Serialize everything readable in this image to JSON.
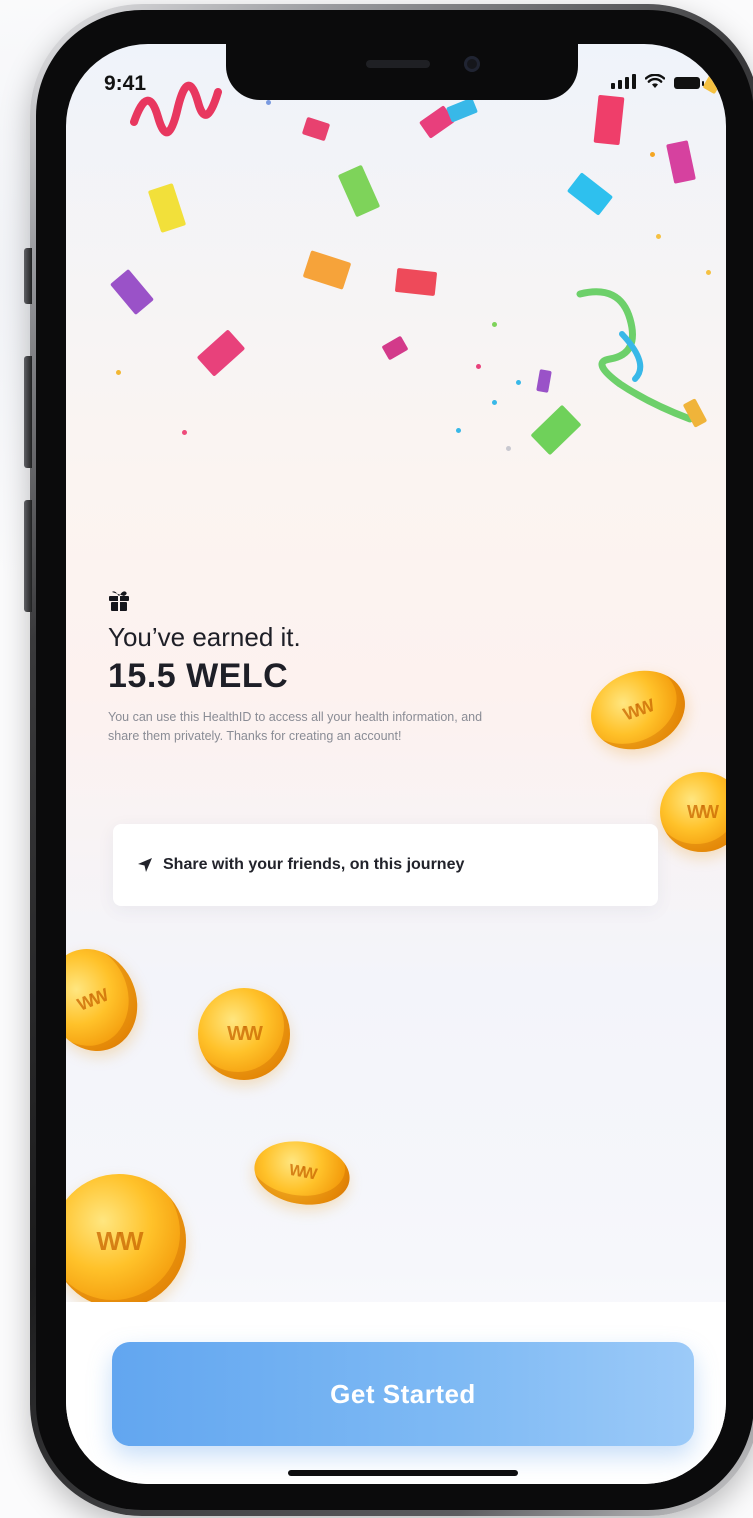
{
  "status_bar": {
    "time": "9:41"
  },
  "reward": {
    "headline": "You’ve earned it.",
    "amount": "15.5 WELC",
    "description": "You can use this HealthID to access all your health information, and share them privately. Thanks for creating an account!"
  },
  "share": {
    "label": "Share with your friends, on this journey"
  },
  "cta": {
    "label": "Get Started"
  },
  "colors": {
    "primary_button": "#6FB0F2",
    "coin_gold": "#FFC22A",
    "text_dark": "#1E1F27"
  },
  "icons": [
    "gift-icon",
    "send-icon",
    "signal-icon",
    "wifi-icon",
    "battery-icon",
    "coin-icon"
  ]
}
